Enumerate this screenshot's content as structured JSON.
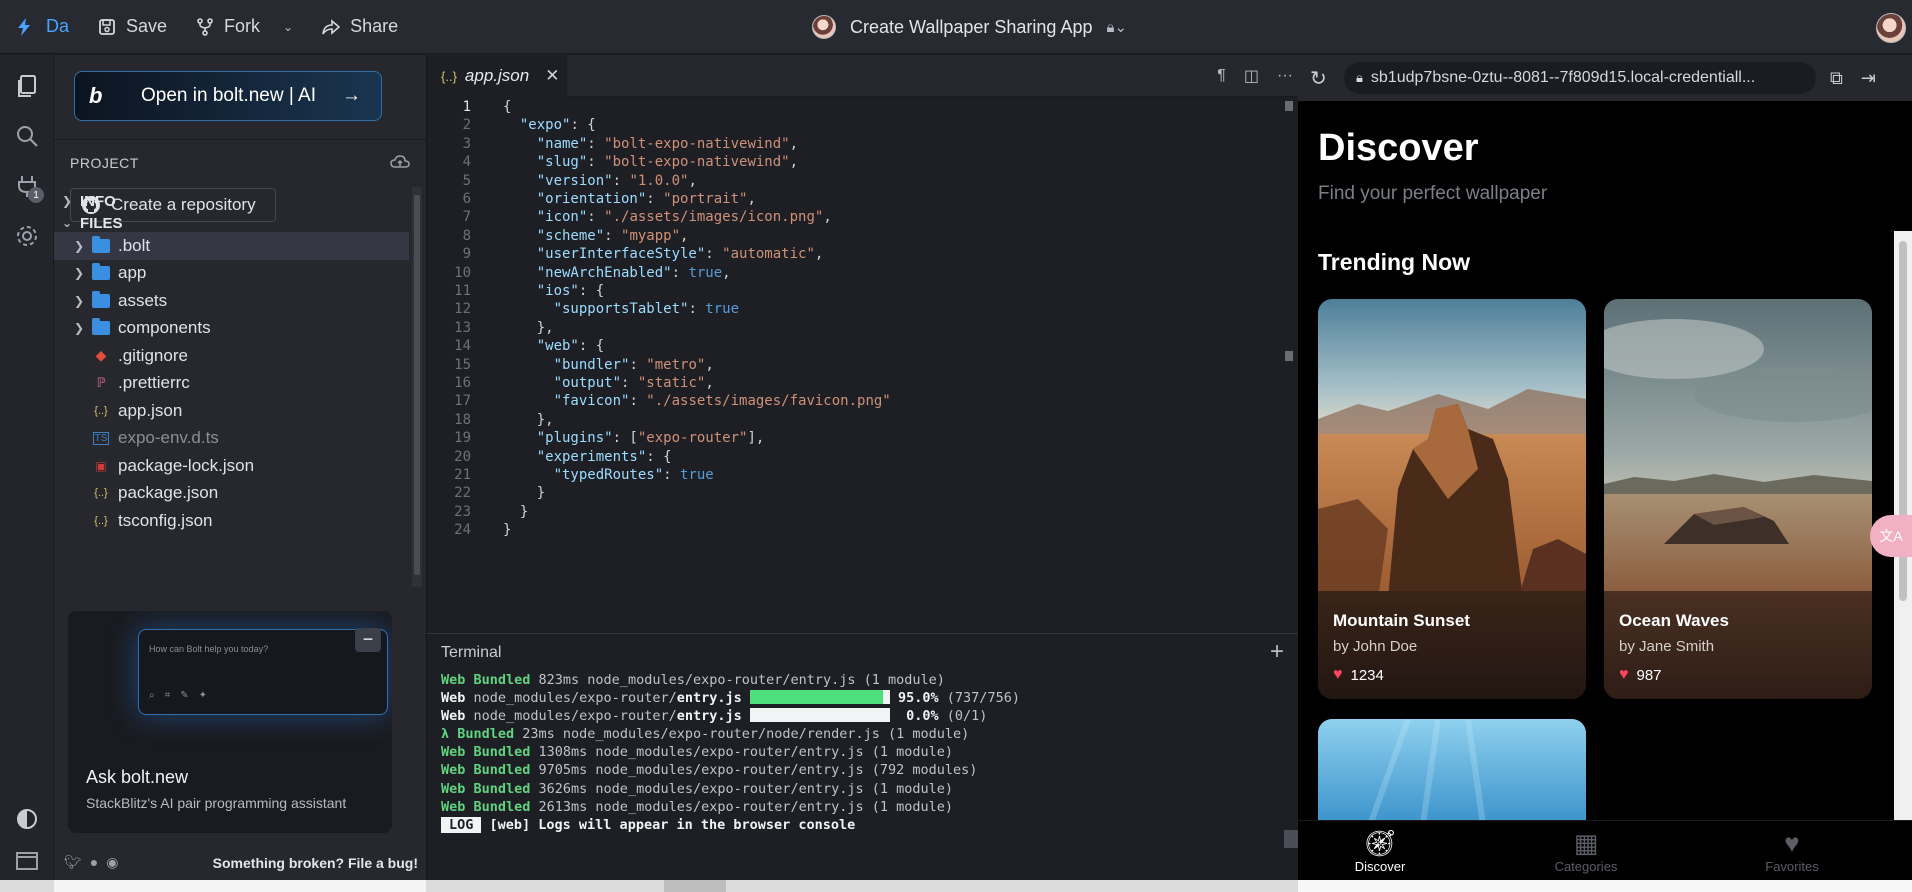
{
  "topbar": {
    "brand": "Da",
    "save": "Save",
    "fork": "Fork",
    "share": "Share",
    "project_title": "Create Wallpaper Sharing App"
  },
  "sidebar": {
    "bolt_button": "Open in bolt.new | AI",
    "project_label": "PROJECT",
    "create_repo": "Create a repository",
    "info_label": "INFO",
    "files_label": "FILES",
    "files": [
      {
        "name": ".bolt",
        "type": "folder"
      },
      {
        "name": "app",
        "type": "folder"
      },
      {
        "name": "assets",
        "type": "folder"
      },
      {
        "name": "components",
        "type": "folder"
      },
      {
        "name": ".gitignore",
        "type": "git"
      },
      {
        "name": ".prettierrc",
        "type": "prettier"
      },
      {
        "name": "app.json",
        "type": "json"
      },
      {
        "name": "expo-env.d.ts",
        "type": "ts"
      },
      {
        "name": "package-lock.json",
        "type": "npm"
      },
      {
        "name": "package.json",
        "type": "json"
      },
      {
        "name": "tsconfig.json",
        "type": "json"
      }
    ],
    "ask_card": {
      "placeholder": "How can Bolt help you today?",
      "title": "Ask bolt.new",
      "subtitle": "StackBlitz's AI pair programming assistant"
    },
    "footer_report": "Something broken? File a bug!",
    "plugin_badge": "1"
  },
  "editor": {
    "tab_name": "app.json",
    "lines": [
      "{",
      "  \"expo\": {",
      "    \"name\": \"bolt-expo-nativewind\",",
      "    \"slug\": \"bolt-expo-nativewind\",",
      "    \"version\": \"1.0.0\",",
      "    \"orientation\": \"portrait\",",
      "    \"icon\": \"./assets/images/icon.png\",",
      "    \"scheme\": \"myapp\",",
      "    \"userInterfaceStyle\": \"automatic\",",
      "    \"newArchEnabled\": true,",
      "    \"ios\": {",
      "      \"supportsTablet\": true",
      "    },",
      "    \"web\": {",
      "      \"bundler\": \"metro\",",
      "      \"output\": \"static\",",
      "      \"favicon\": \"./assets/images/favicon.png\"",
      "    },",
      "    \"plugins\": [\"expo-router\"],",
      "    \"experiments\": {",
      "      \"typedRoutes\": true",
      "    }",
      "  }",
      "}"
    ]
  },
  "terminal": {
    "title": "Terminal",
    "lines": [
      {
        "prefix": "Web Bundled",
        "text": " 823ms node_modules/expo-router/entry.js (1 module)"
      },
      {
        "prefix": "Web",
        "path": " node_modules/expo-router/",
        "file": "entry.js",
        "progress": 0.95,
        "pct": "95.0%",
        "count": "(737/756)"
      },
      {
        "prefix": "Web",
        "path": " node_modules/expo-router/",
        "file": "entry.js",
        "progress": 0.0,
        "pct": "0.0%",
        "count": "(0/1)"
      },
      {
        "prefix": "λ Bundled",
        "text": " 23ms node_modules/expo-router/node/render.js (1 module)"
      },
      {
        "prefix": "Web Bundled",
        "text": " 1308ms node_modules/expo-router/entry.js (1 module)"
      },
      {
        "prefix": "Web Bundled",
        "text": " 9705ms node_modules/expo-router/entry.js (792 modules)"
      },
      {
        "prefix": "Web Bundled",
        "text": " 3626ms node_modules/expo-router/entry.js (1 module)"
      },
      {
        "prefix": "Web Bundled",
        "text": " 2613ms node_modules/expo-router/entry.js (1 module)"
      }
    ],
    "log_tag": "LOG",
    "log_text": " [web] Logs will appear in the browser console"
  },
  "preview": {
    "url": "sb1udp7bsne-0ztu--8081--7f809d15.local-credentiall...",
    "title": "Discover",
    "subtitle": "Find your perfect wallpaper",
    "section": "Trending Now",
    "cards": [
      {
        "title": "Mountain Sunset",
        "author": "by John Doe",
        "likes": "1234"
      },
      {
        "title": "Ocean Waves",
        "author": "by Jane Smith",
        "likes": "987"
      }
    ],
    "nav": [
      "Discover",
      "Categories",
      "Favorites"
    ]
  }
}
